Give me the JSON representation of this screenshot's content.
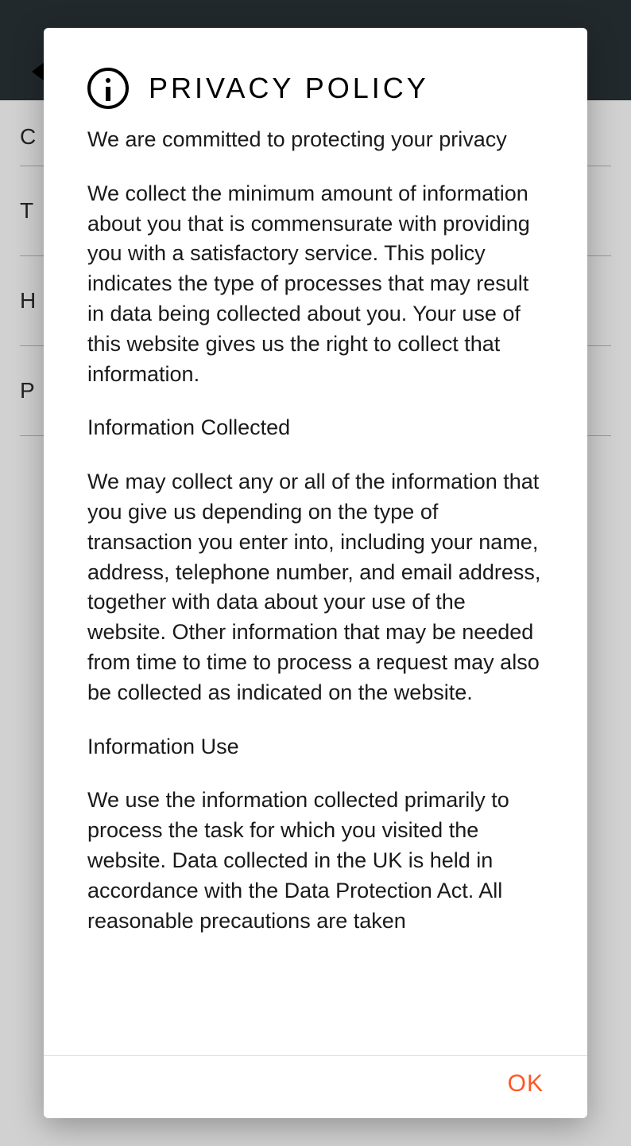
{
  "bg": {
    "items": [
      "C",
      "T",
      "H",
      "P"
    ]
  },
  "dialog": {
    "title": "PRIVACY POLICY",
    "subtitle": "We are committed to protecting your privacy",
    "paragraphs": {
      "intro": " We collect the minimum amount of information about you that is commensurate with providing you with a satisfactory service. This policy indicates the type of processes that may result in data being collected about you. Your use of this website gives us the right to collect that information.",
      "heading1": "Information Collected",
      "p1": " We may collect any or all of the information that you give us depending on the type of transaction you enter into, including your name, address, telephone number, and email address, together with data about your use of the website. Other information that may be needed from time to time to process a request may also be collected as indicated on the website.",
      "heading2": "Information Use",
      "p2": " We use the information collected primarily to process the task for which you visited the website. Data collected in the UK is held in accordance with the Data Protection Act. All reasonable precautions are taken"
    },
    "ok_label": "OK"
  }
}
